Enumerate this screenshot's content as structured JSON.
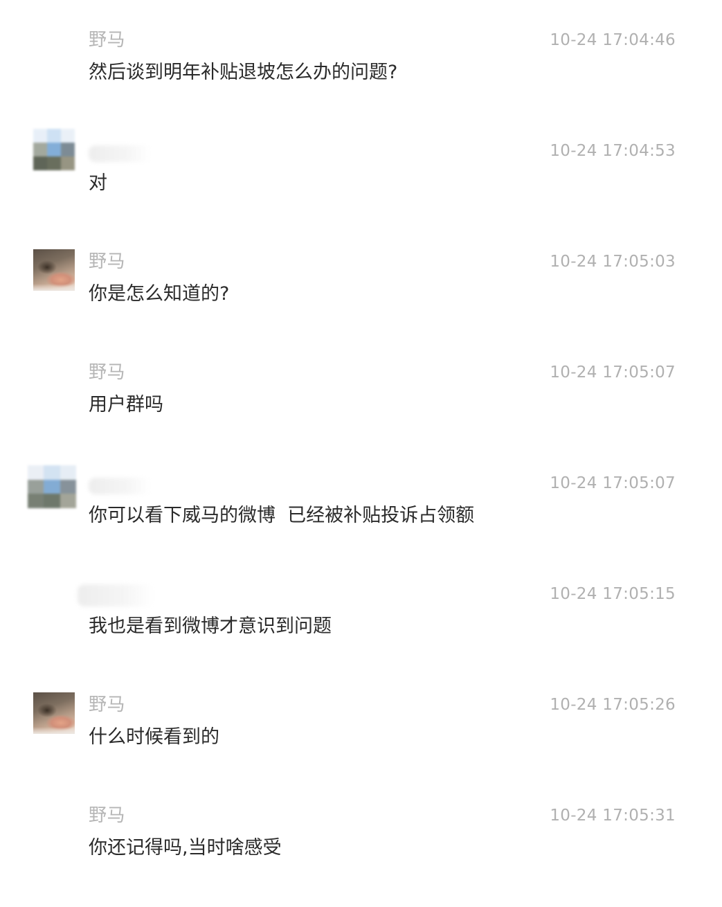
{
  "messages": [
    {
      "sender": "野马",
      "text": "然后谈到明年补贴退坡怎么办的问题?",
      "timestamp": "10-24 17:04:46",
      "avatar": "none",
      "sender_hidden": false
    },
    {
      "sender": "",
      "text": "对",
      "timestamp": "10-24 17:04:53",
      "avatar": "mosaic",
      "sender_hidden": true
    },
    {
      "sender": "野马",
      "text": "你是怎么知道的?",
      "timestamp": "10-24 17:05:03",
      "avatar": "photo",
      "sender_hidden": false
    },
    {
      "sender": "野马",
      "text": "用户群吗",
      "timestamp": "10-24 17:05:07",
      "avatar": "none",
      "sender_hidden": false
    },
    {
      "sender": "",
      "text": "你可以看下威马的微博  已经被补贴投诉占领额",
      "timestamp": "10-24 17:05:07",
      "avatar": "mosaic",
      "sender_hidden": true
    },
    {
      "sender": "",
      "text": "我也是看到微博才意识到问题",
      "timestamp": "10-24 17:05:15",
      "avatar": "none",
      "sender_hidden": true
    },
    {
      "sender": "野马",
      "text": "什么时候看到的",
      "timestamp": "10-24 17:05:26",
      "avatar": "photo",
      "sender_hidden": false
    },
    {
      "sender": "野马",
      "text": "你还记得吗,当时啥感受",
      "timestamp": "10-24 17:05:31",
      "avatar": "none",
      "sender_hidden": false
    }
  ],
  "colors": {
    "sender": "#b5b5b5",
    "text": "#2a2a2a",
    "timestamp": "#b0b0b0",
    "background": "#ffffff"
  }
}
